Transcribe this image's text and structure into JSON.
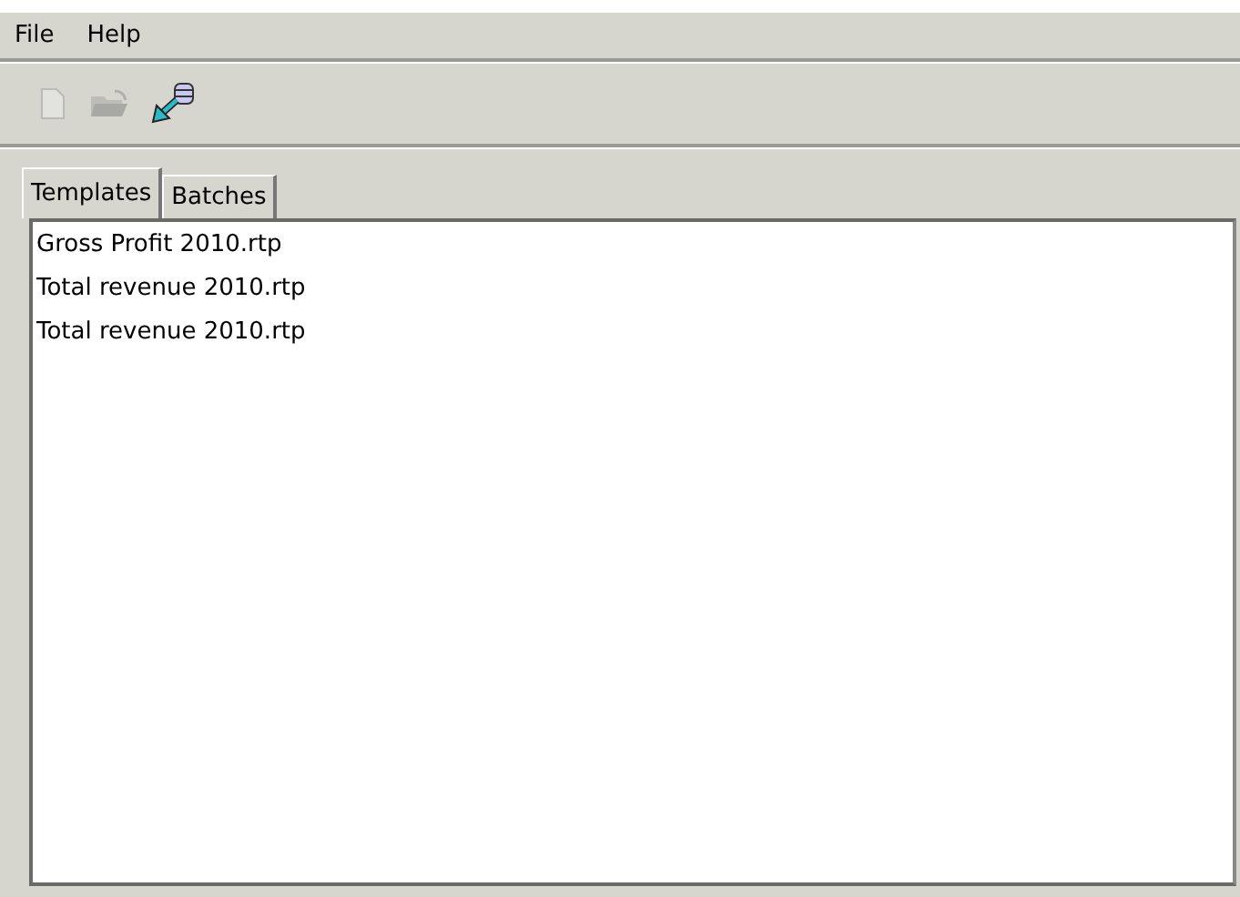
{
  "menu": [
    {
      "label": "File"
    },
    {
      "label": "Help"
    }
  ],
  "toolbar": [
    {
      "kind": "new",
      "disabled": true
    },
    {
      "kind": "open",
      "disabled": true
    },
    {
      "kind": "connect",
      "disabled": false
    }
  ],
  "tabs": [
    {
      "label": "Templates",
      "selected": true
    },
    {
      "label": "Batches",
      "selected": false
    }
  ],
  "list": [
    {
      "label": "Gross Profit 2010.rtp"
    },
    {
      "label": "Total revenue 2010.rtp"
    },
    {
      "label": "Total revenue 2010.rtp"
    }
  ]
}
